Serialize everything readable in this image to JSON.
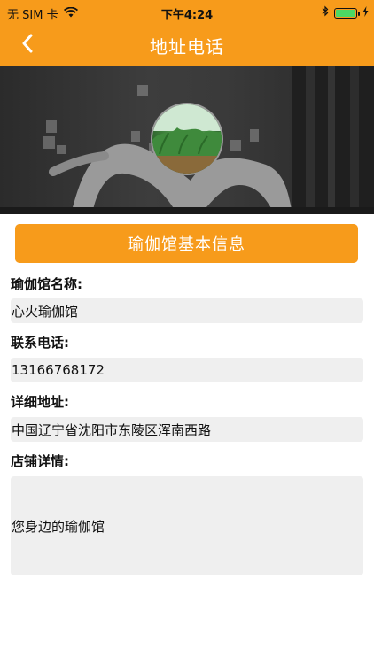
{
  "status_bar": {
    "carrier": "无 SIM 卡",
    "time": "下午4:24",
    "battery_color": "#4CD964"
  },
  "nav": {
    "title": "地址电话",
    "back_icon": "chevron-left-icon"
  },
  "theme": {
    "accent": "#F79B1B",
    "field_bg": "#efefef"
  },
  "section": {
    "button_label": "瑜伽馆基本信息"
  },
  "form": {
    "name_label": "瑜伽馆名称:",
    "name_value": "心火瑜伽馆",
    "phone_label": "联系电话:",
    "phone_value": "13166768172",
    "address_label": "详细地址:",
    "address_value": "中国辽宁省沈阳市东陵区浑南西路",
    "details_label": "店铺详情:",
    "details_value": "您身边的瑜伽馆"
  }
}
